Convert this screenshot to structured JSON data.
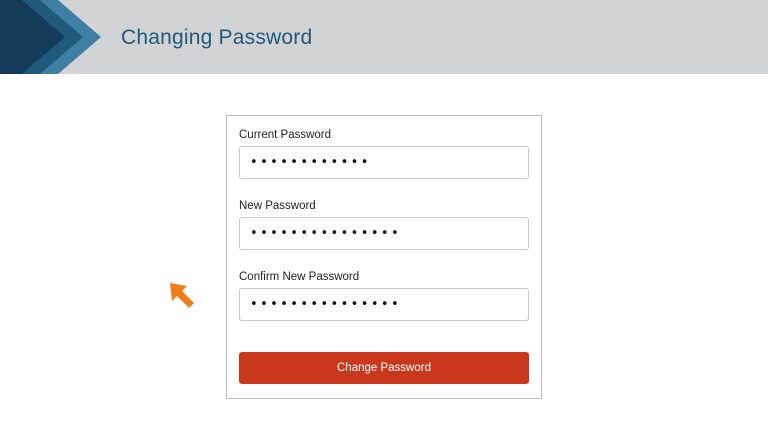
{
  "header": {
    "title": "Changing Password"
  },
  "form": {
    "current": {
      "label": "Current Password",
      "value": "••••••••••••"
    },
    "new": {
      "label": "New Password",
      "value": "•••••••••••••••"
    },
    "confirm": {
      "label": "Confirm New Password",
      "value": "•••••••••••••••"
    },
    "submit_label": "Change Password"
  },
  "icons": {
    "header_logo": "chevron-logo-icon",
    "pointer": "arrow-pointer-icon"
  },
  "colors": {
    "header_bg": "#d2d3d5",
    "title": "#1f5a7c",
    "chevron_dark": "#143a5a",
    "chevron_mid": "#1f5a7c",
    "chevron_light": "#3e7fa3",
    "button": "#c9381c",
    "pointer": "#ef7d1a"
  }
}
